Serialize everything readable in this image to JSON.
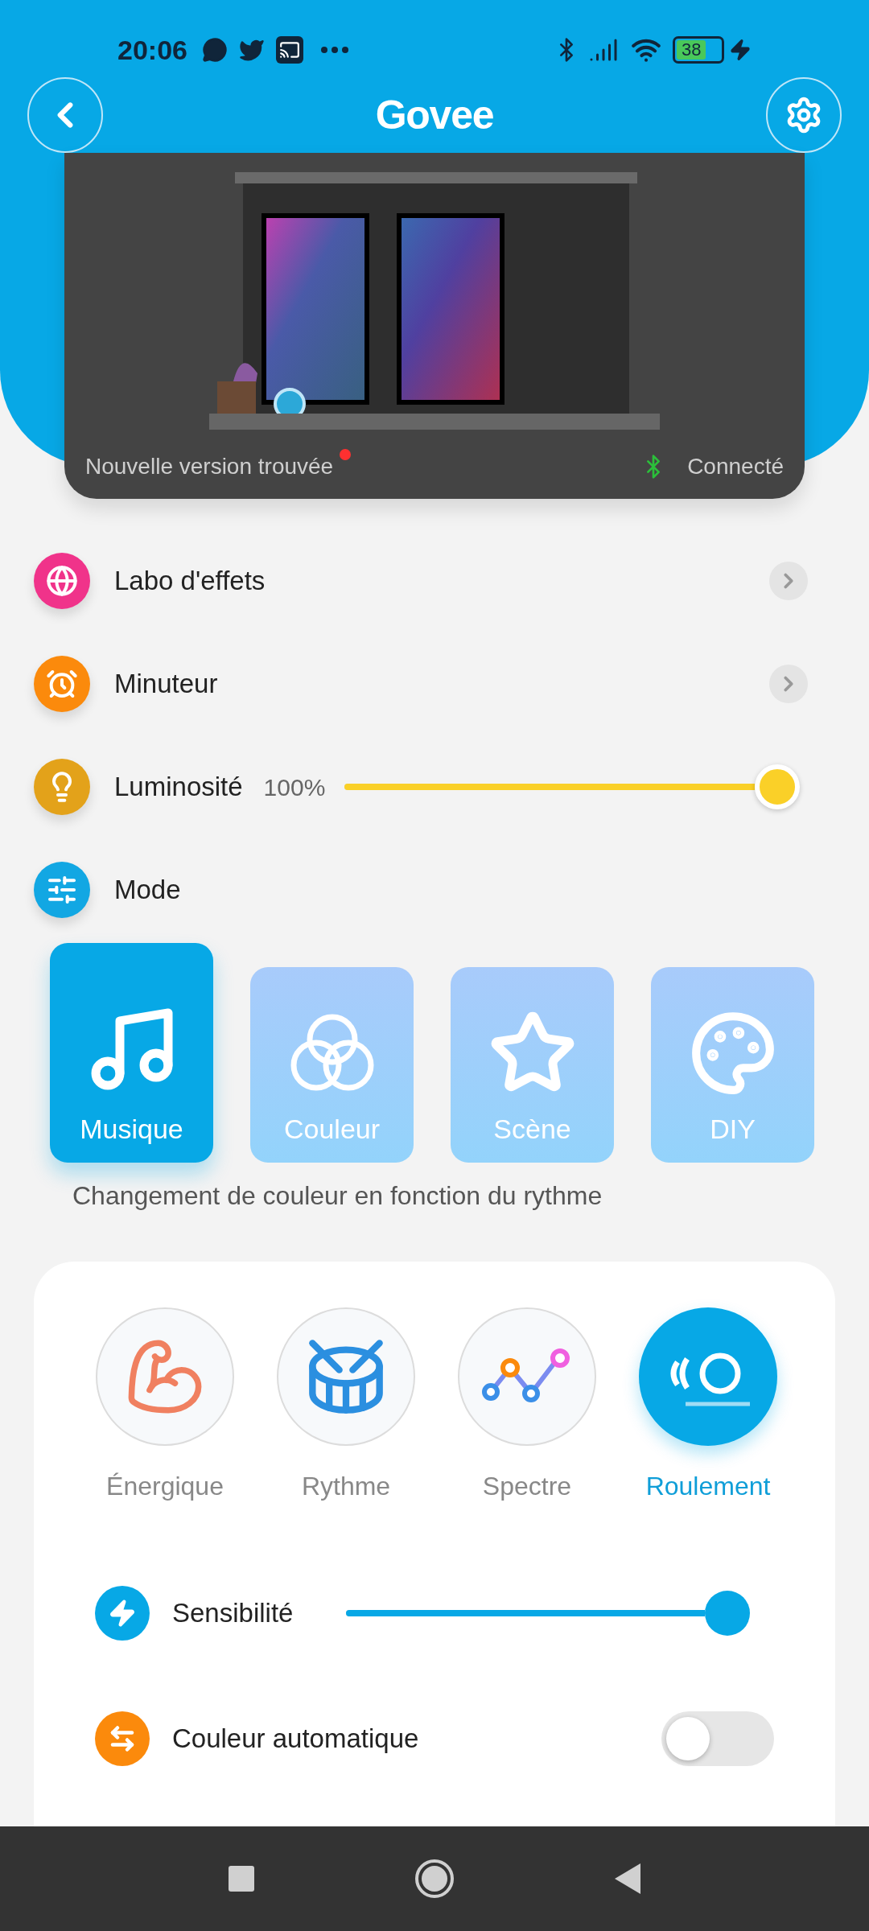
{
  "status_bar": {
    "time": "20:06",
    "battery": "38"
  },
  "header": {
    "logo": "Govee"
  },
  "device": {
    "update_text": "Nouvelle version trouvée",
    "update_dot": true,
    "connection": "Connecté"
  },
  "menu": [
    {
      "kind": "link",
      "label": "Labo d'effets",
      "color": "#f0338a"
    },
    {
      "kind": "link",
      "label": "Minuteur",
      "color": "#fb8a0c"
    },
    {
      "kind": "slider",
      "label": "Luminosité",
      "reading": "100%",
      "level": 1,
      "color": "#e3a21a"
    },
    {
      "kind": "header",
      "label": "Mode",
      "color": "#12a7e3"
    }
  ],
  "modes": [
    {
      "label": "Musique",
      "selected": true
    },
    {
      "label": "Couleur",
      "selected": false
    },
    {
      "label": "Scène",
      "selected": false
    },
    {
      "label": "DIY",
      "selected": false
    }
  ],
  "mode_description": "Changement de couleur en fonction du rythme",
  "effects": [
    {
      "label": "Énergique",
      "selected": false
    },
    {
      "label": "Rythme",
      "selected": false
    },
    {
      "label": "Spectre",
      "selected": false
    },
    {
      "label": "Roulement",
      "selected": true
    }
  ],
  "settings": [
    {
      "kind": "slider",
      "label": "Sensibilité",
      "level": 1
    },
    {
      "kind": "toggle",
      "label": "Couleur automatique",
      "on": false
    }
  ]
}
